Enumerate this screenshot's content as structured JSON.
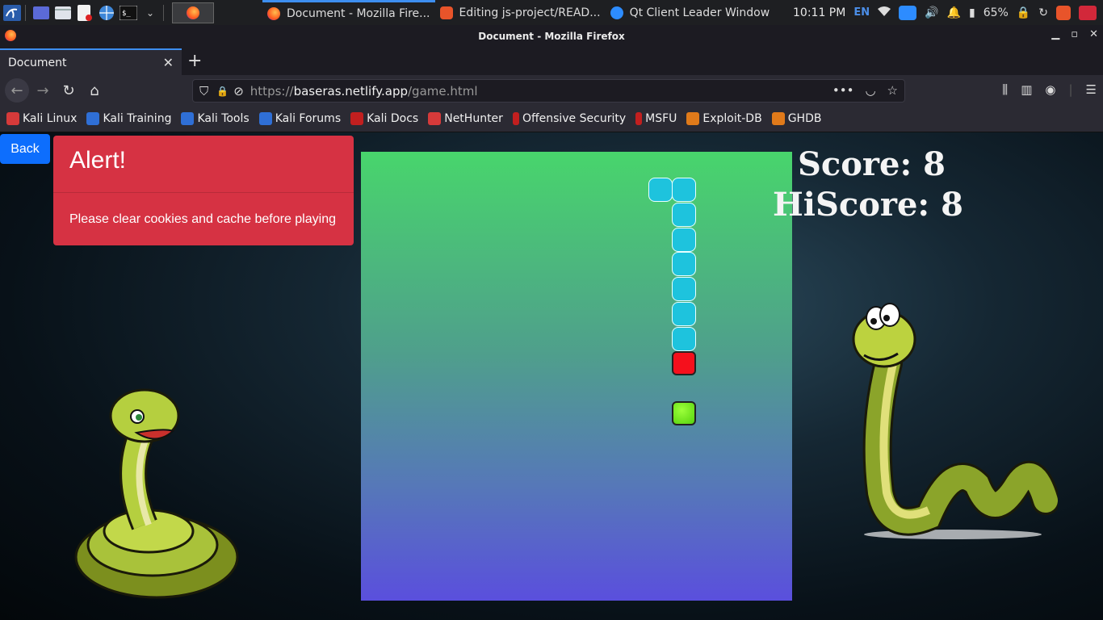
{
  "system_panel": {
    "tasks": [
      {
        "label": "Document - Mozilla Fire..."
      },
      {
        "label": "Editing js-project/READ..."
      },
      {
        "label": "Qt Client Leader Window"
      }
    ],
    "clock": "10:11 PM",
    "language": "EN",
    "battery": "65%"
  },
  "window": {
    "title": "Document - Mozilla Firefox"
  },
  "tab": {
    "title": "Document"
  },
  "urlbar": {
    "scheme": "https://",
    "domain": "baseras.netlify.app",
    "path": "/game.html"
  },
  "bookmarks": [
    {
      "label": "Kali Linux",
      "color": "#d63a3a"
    },
    {
      "label": "Kali Training",
      "color": "#2f6fd6"
    },
    {
      "label": "Kali Tools",
      "color": "#2f6fd6"
    },
    {
      "label": "Kali Forums",
      "color": "#2f6fd6"
    },
    {
      "label": "Kali Docs",
      "color": "#c21f1f"
    },
    {
      "label": "NetHunter",
      "color": "#d63a3a"
    },
    {
      "label": "Offensive Security",
      "color": "#c21f1f"
    },
    {
      "label": "MSFU",
      "color": "#c21f1f"
    },
    {
      "label": "Exploit-DB",
      "color": "#e07a1a"
    },
    {
      "label": "GHDB",
      "color": "#e07a1a"
    }
  ],
  "page": {
    "back_label": "Back",
    "alert_title": "Alert!",
    "alert_message": "Please clear cookies and cache before playing",
    "score_text": "Score: 8",
    "hiscore_text": "HiScore: 8",
    "snake_color": "#1ec3dd",
    "head_color": "#f5101c",
    "food_color": "#55d10d"
  }
}
